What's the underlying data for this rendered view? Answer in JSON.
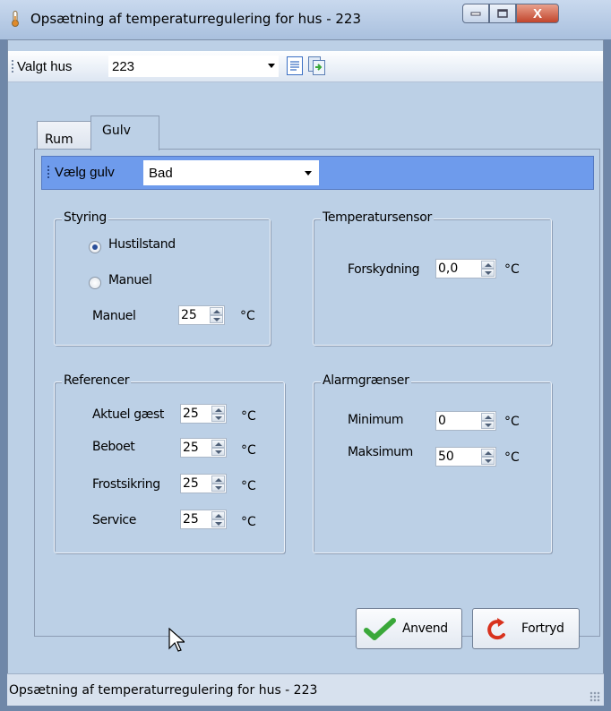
{
  "window": {
    "title": "Opsætning af temperaturregulering for hus - 223",
    "close_glyph": "X"
  },
  "toolbar": {
    "house_label": "Valgt hus",
    "house_value": "223"
  },
  "tabs": [
    {
      "label": "Rum"
    },
    {
      "label": "Gulv"
    }
  ],
  "floor": {
    "label": "Vælg gulv",
    "value": "Bad"
  },
  "styring": {
    "title": "Styring",
    "option_hustilstand": "Hustilstand",
    "option_manuel": "Manuel",
    "selected": "Hustilstand",
    "manuel_label": "Manuel",
    "manuel_value": "25",
    "unit": "°C"
  },
  "temperatursensor": {
    "title": "Temperatursensor",
    "offset_label": "Forskydning",
    "offset_value": "0,0",
    "unit": "°C"
  },
  "referencer": {
    "title": "Referencer",
    "rows": [
      {
        "label": "Aktuel gæst",
        "value": "25",
        "unit": "°C"
      },
      {
        "label": "Beboet",
        "value": "25",
        "unit": "°C"
      },
      {
        "label": "Frostsikring",
        "value": "25",
        "unit": "°C"
      },
      {
        "label": "Service",
        "value": "25",
        "unit": "°C"
      }
    ]
  },
  "alarmgraenser": {
    "title": "Alarmgrænser",
    "min_label": "Minimum",
    "min_value": "0",
    "max_label": "Maksimum",
    "max_value": "50",
    "unit": "°C"
  },
  "actions": {
    "apply_label": "Anvend",
    "undo_label": "Fortryd"
  },
  "statusbar": {
    "text": "Opsætning af temperaturregulering for hus - 223"
  },
  "colors": {
    "accent_floorbar": "#6e9bec",
    "client_bg": "#bcd0e6",
    "apply_icon": "#3aa83a",
    "undo_icon": "#d8321e",
    "close_button": "#c2452c"
  },
  "icons": [
    "thermometer-icon",
    "minimize-icon",
    "maximize-icon",
    "close-icon",
    "document-icon",
    "export-icon",
    "checkmark-icon",
    "undo-arrow-icon",
    "mouse-cursor-icon",
    "dropdown-arrow-icon"
  ]
}
